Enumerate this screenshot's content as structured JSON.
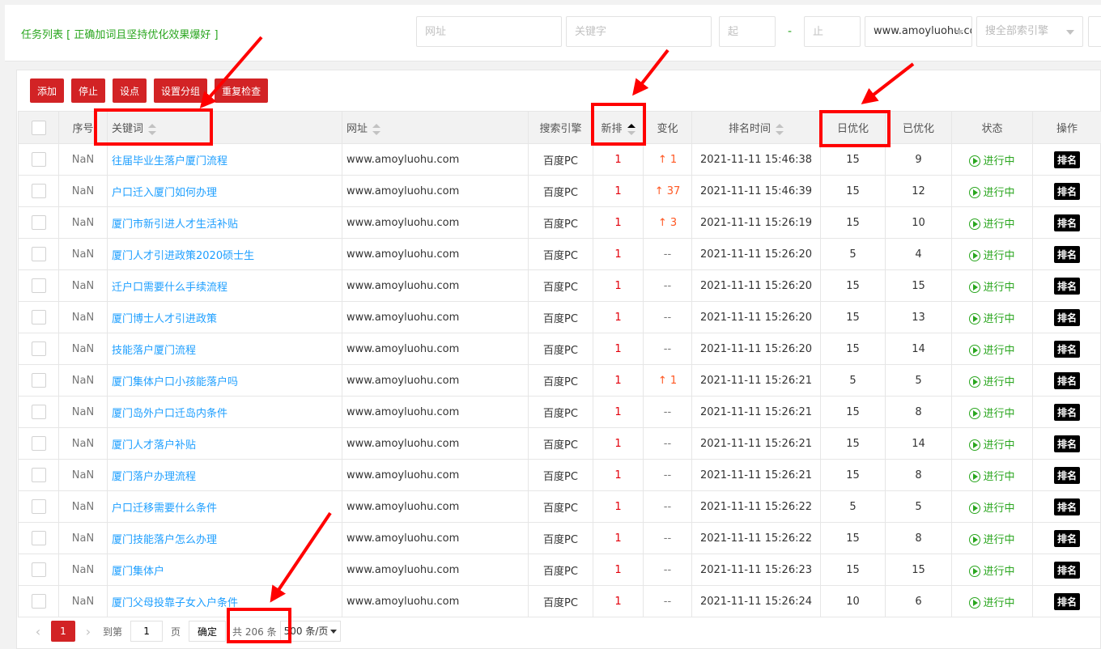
{
  "header": {
    "title": "任务列表 [ 正确加词且坚持优化效果爆好 ]",
    "url_placeholder": "网址",
    "keyword_placeholder": "关键字",
    "start_placeholder": "起",
    "dash": "-",
    "end_placeholder": "止",
    "domain_select": "www.amoyluohu.com",
    "engine_select": "搜全部索引擎"
  },
  "toolbar": {
    "add": "添加",
    "stop": "停止",
    "set_point": "设点",
    "set_group": "设置分组",
    "recheck": "重复检查"
  },
  "table": {
    "columns": [
      "序号",
      "关键词",
      "网址",
      "搜索引擎",
      "新排",
      "变化",
      "排名时间",
      "日优化",
      "已优化",
      "状态",
      "操作"
    ],
    "status_label": "进行中",
    "action_label": "排名",
    "rows": [
      {
        "seq": "NaN",
        "keyword": "往届毕业生落户厦门流程",
        "url": "www.amoyluohu.com",
        "engine": "百度PC",
        "rank": "1",
        "change": "↑ 1",
        "time": "2021-11-11 15:46:38",
        "daily": "15",
        "done": "9"
      },
      {
        "seq": "NaN",
        "keyword": "户口迁入厦门如何办理",
        "url": "www.amoyluohu.com",
        "engine": "百度PC",
        "rank": "1",
        "change": "↑ 37",
        "time": "2021-11-11 15:46:39",
        "daily": "15",
        "done": "12"
      },
      {
        "seq": "NaN",
        "keyword": "厦门市新引进人才生活补贴",
        "url": "www.amoyluohu.com",
        "engine": "百度PC",
        "rank": "1",
        "change": "↑ 3",
        "time": "2021-11-11 15:26:19",
        "daily": "15",
        "done": "10"
      },
      {
        "seq": "NaN",
        "keyword": "厦门人才引进政策2020硕士生",
        "url": "www.amoyluohu.com",
        "engine": "百度PC",
        "rank": "1",
        "change": "--",
        "time": "2021-11-11 15:26:20",
        "daily": "5",
        "done": "4"
      },
      {
        "seq": "NaN",
        "keyword": "迁户口需要什么手续流程",
        "url": "www.amoyluohu.com",
        "engine": "百度PC",
        "rank": "1",
        "change": "--",
        "time": "2021-11-11 15:26:20",
        "daily": "15",
        "done": "15"
      },
      {
        "seq": "NaN",
        "keyword": "厦门博士人才引进政策",
        "url": "www.amoyluohu.com",
        "engine": "百度PC",
        "rank": "1",
        "change": "--",
        "time": "2021-11-11 15:26:20",
        "daily": "15",
        "done": "13"
      },
      {
        "seq": "NaN",
        "keyword": "技能落户厦门流程",
        "url": "www.amoyluohu.com",
        "engine": "百度PC",
        "rank": "1",
        "change": "--",
        "time": "2021-11-11 15:26:20",
        "daily": "15",
        "done": "14"
      },
      {
        "seq": "NaN",
        "keyword": "厦门集体户口小孩能落户吗",
        "url": "www.amoyluohu.com",
        "engine": "百度PC",
        "rank": "1",
        "change": "↑ 1",
        "time": "2021-11-11 15:26:21",
        "daily": "5",
        "done": "5"
      },
      {
        "seq": "NaN",
        "keyword": "厦门岛外户口迁岛内条件",
        "url": "www.amoyluohu.com",
        "engine": "百度PC",
        "rank": "1",
        "change": "--",
        "time": "2021-11-11 15:26:21",
        "daily": "15",
        "done": "8"
      },
      {
        "seq": "NaN",
        "keyword": "厦门人才落户补贴",
        "url": "www.amoyluohu.com",
        "engine": "百度PC",
        "rank": "1",
        "change": "--",
        "time": "2021-11-11 15:26:21",
        "daily": "15",
        "done": "14"
      },
      {
        "seq": "NaN",
        "keyword": "厦门落户办理流程",
        "url": "www.amoyluohu.com",
        "engine": "百度PC",
        "rank": "1",
        "change": "--",
        "time": "2021-11-11 15:26:21",
        "daily": "15",
        "done": "8"
      },
      {
        "seq": "NaN",
        "keyword": "户口迁移需要什么条件",
        "url": "www.amoyluohu.com",
        "engine": "百度PC",
        "rank": "1",
        "change": "--",
        "time": "2021-11-11 15:26:22",
        "daily": "5",
        "done": "5"
      },
      {
        "seq": "NaN",
        "keyword": "厦门技能落户怎么办理",
        "url": "www.amoyluohu.com",
        "engine": "百度PC",
        "rank": "1",
        "change": "--",
        "time": "2021-11-11 15:26:22",
        "daily": "15",
        "done": "8"
      },
      {
        "seq": "NaN",
        "keyword": "厦门集体户",
        "url": "www.amoyluohu.com",
        "engine": "百度PC",
        "rank": "1",
        "change": "--",
        "time": "2021-11-11 15:26:23",
        "daily": "15",
        "done": "15"
      },
      {
        "seq": "NaN",
        "keyword": "厦门父母投靠子女入户条件",
        "url": "www.amoyluohu.com",
        "engine": "百度PC",
        "rank": "1",
        "change": "--",
        "time": "2021-11-11 15:26:24",
        "daily": "10",
        "done": "6"
      }
    ]
  },
  "pager": {
    "current": "1",
    "goto_label": "到第",
    "goto_value": "1",
    "page_unit": "页",
    "confirm": "确定",
    "total": "共 206 条",
    "page_size": "500 条/页"
  },
  "colors": {
    "accent_red": "#d22325",
    "title_green": "#2aa61f",
    "keyword_blue": "#1e9fff",
    "annotation_red": "#ff0000"
  }
}
